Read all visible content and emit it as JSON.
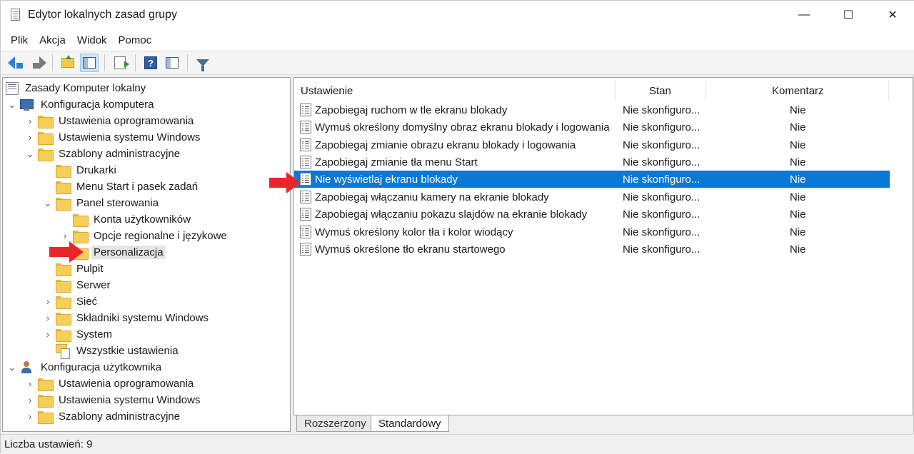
{
  "window": {
    "title": "Edytor lokalnych zasad grupy",
    "controls": {
      "minimize": "—",
      "maximize": "☐",
      "close": "✕"
    }
  },
  "menu": {
    "items": [
      {
        "label": "Plik"
      },
      {
        "label": "Akcja"
      },
      {
        "label": "Widok"
      },
      {
        "label": "Pomoc"
      }
    ]
  },
  "toolbar": {
    "buttons": [
      "back-icon",
      "forward-icon",
      "up-folder-icon",
      "show-hide-tree-icon",
      "export-list-icon",
      "help-icon",
      "extended-view-icon",
      "filter-icon"
    ]
  },
  "tree": {
    "items": [
      {
        "label": "Zasady Komputer lokalny",
        "icon": "book-icon",
        "chevron": ""
      },
      {
        "label": "Konfiguracja komputera",
        "icon": "computer-icon",
        "chevron": "⌄"
      },
      {
        "label": "Ustawienia oprogramowania",
        "icon": "folder-icon",
        "chevron": "›"
      },
      {
        "label": "Ustawienia systemu Windows",
        "icon": "folder-icon",
        "chevron": "›"
      },
      {
        "label": "Szablony administracyjne",
        "icon": "folder-icon",
        "chevron": "⌄"
      },
      {
        "label": "Drukarki",
        "icon": "folder-icon",
        "chevron": ""
      },
      {
        "label": "Menu Start i pasek zadań",
        "icon": "folder-icon",
        "chevron": ""
      },
      {
        "label": "Panel sterowania",
        "icon": "folder-icon",
        "chevron": "⌄"
      },
      {
        "label": "Konta użytkowników",
        "icon": "folder-icon",
        "chevron": ""
      },
      {
        "label": "Opcje regionalne i językowe",
        "icon": "folder-icon",
        "chevron": "›"
      },
      {
        "label": "Personalizacja",
        "icon": "folder-icon",
        "chevron": "",
        "selected": true
      },
      {
        "label": "Pulpit",
        "icon": "folder-icon",
        "chevron": ""
      },
      {
        "label": "Serwer",
        "icon": "folder-icon",
        "chevron": ""
      },
      {
        "label": "Sieć",
        "icon": "folder-icon",
        "chevron": "›"
      },
      {
        "label": "Składniki systemu Windows",
        "icon": "folder-icon",
        "chevron": "›"
      },
      {
        "label": "System",
        "icon": "folder-icon",
        "chevron": "›"
      },
      {
        "label": "Wszystkie ustawienia",
        "icon": "all-settings-icon",
        "chevron": ""
      },
      {
        "label": "Konfiguracja użytkownika",
        "icon": "user-icon",
        "chevron": "⌄"
      },
      {
        "label": "Ustawienia oprogramowania",
        "icon": "folder-icon",
        "chevron": "›"
      },
      {
        "label": "Ustawienia systemu Windows",
        "icon": "folder-icon",
        "chevron": "›"
      },
      {
        "label": "Szablony administracyjne",
        "icon": "folder-icon",
        "chevron": "›"
      }
    ]
  },
  "list": {
    "columns": {
      "setting": "Ustawienie",
      "state": "Stan",
      "comment": "Komentarz"
    },
    "rows": [
      {
        "setting": "Zapobiegaj ruchom w tle ekranu blokady",
        "state": "Nie skonfiguro...",
        "comment": "Nie"
      },
      {
        "setting": "Wymuś określony domyślny obraz ekranu blokady i logowania",
        "state": "Nie skonfiguro...",
        "comment": "Nie"
      },
      {
        "setting": "Zapobiegaj zmianie obrazu ekranu blokady i logowania",
        "state": "Nie skonfiguro...",
        "comment": "Nie"
      },
      {
        "setting": "Zapobiegaj zmianie tła menu Start",
        "state": "Nie skonfiguro...",
        "comment": "Nie"
      },
      {
        "setting": "Nie wyświetlaj ekranu blokady",
        "state": "Nie skonfiguro...",
        "comment": "Nie",
        "selected": true
      },
      {
        "setting": "Zapobiegaj włączaniu kamery na ekranie blokady",
        "state": "Nie skonfiguro...",
        "comment": "Nie"
      },
      {
        "setting": "Zapobiegaj włączaniu pokazu slajdów na ekranie blokady",
        "state": "Nie skonfiguro...",
        "comment": "Nie"
      },
      {
        "setting": "Wymuś określony kolor tła i kolor wiodący",
        "state": "Nie skonfiguro...",
        "comment": "Nie"
      },
      {
        "setting": "Wymuś określone tło ekranu startowego",
        "state": "Nie skonfiguro...",
        "comment": "Nie"
      }
    ]
  },
  "tabs": [
    {
      "label": "Rozszerzony",
      "active": false
    },
    {
      "label": "Standardowy",
      "active": true
    }
  ],
  "status": {
    "text": "Liczba ustawień: 9"
  },
  "colors": {
    "selection": "#0a78d4",
    "annotation_arrow": "#e8262a"
  }
}
